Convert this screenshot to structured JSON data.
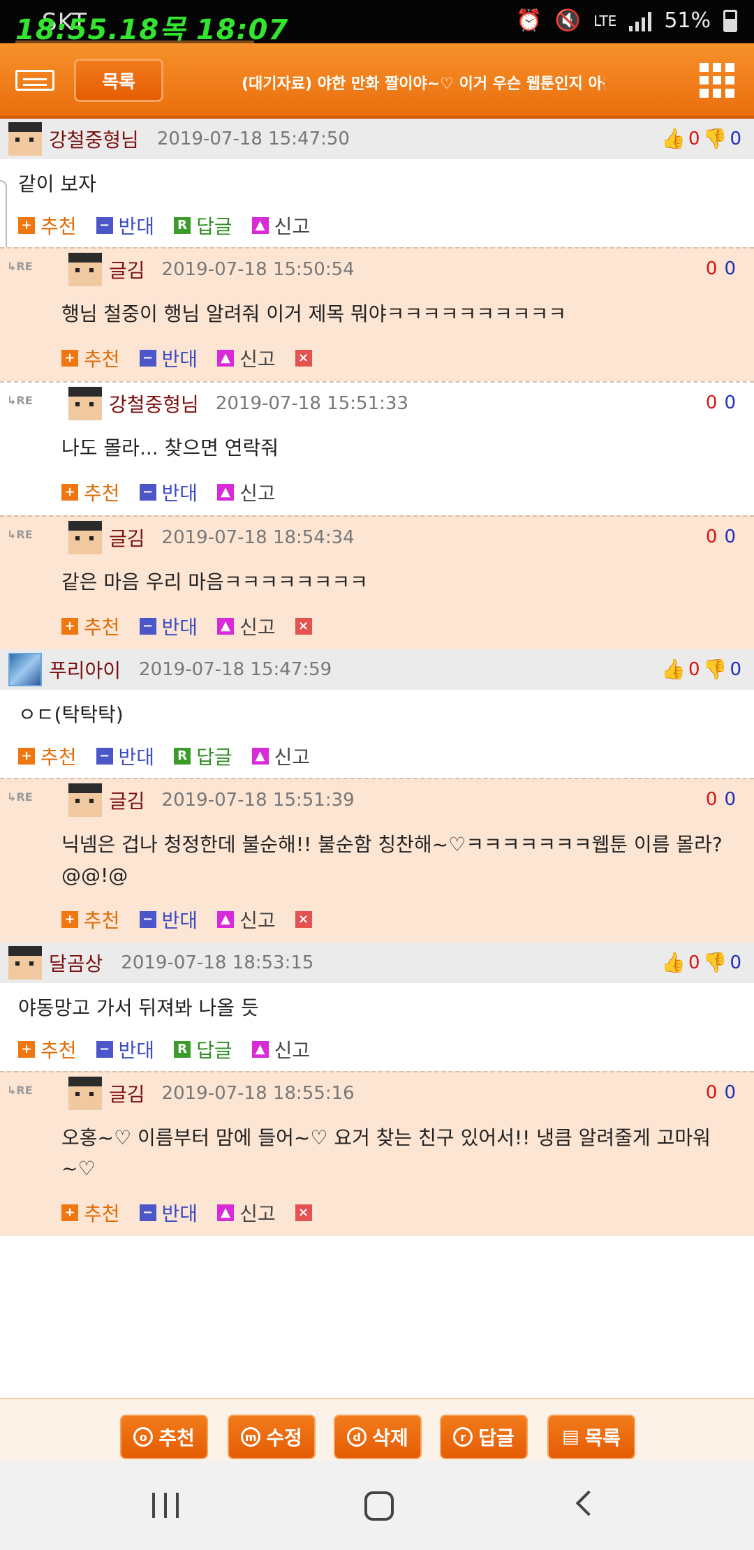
{
  "status": {
    "carrier": "SKT",
    "overlay": "18:55.18목 18:07",
    "lte": "LTE",
    "battery": "51%"
  },
  "header": {
    "list_button": "목록",
    "title": "(대기자료) 야한 만화 짤이야~♡ 이거 우슨 웹툰인지 아는 사.."
  },
  "labels": {
    "recommend": "추천",
    "oppose": "반대",
    "reply": "답글",
    "report": "신고",
    "re": "RE",
    "zero": "0"
  },
  "comments": [
    {
      "user": "강철중형님",
      "date": "2019-07-18 15:47:50",
      "up": "0",
      "down": "0",
      "text": "같이 보자",
      "replies": [
        {
          "user": "글김",
          "date": "2019-07-18 15:50:54",
          "text": "행님 철중이 행님 알려줘 이거 제목 뭐야ㅋㅋㅋㅋㅋㅋㅋㅋㅋㅋ",
          "up": "0",
          "down": "0",
          "deletable": true,
          "bg": "tan"
        },
        {
          "user": "강철중형님",
          "date": "2019-07-18 15:51:33",
          "text": "나도 몰라... 찾으면 연락줘",
          "up": "0",
          "down": "0",
          "deletable": false,
          "bg": "white"
        },
        {
          "user": "글김",
          "date": "2019-07-18 18:54:34",
          "text": "같은 마음 우리 마음ㅋㅋㅋㅋㅋㅋㅋㅋ",
          "up": "0",
          "down": "0",
          "deletable": true,
          "bg": "tan"
        }
      ]
    },
    {
      "user": "푸리아이",
      "date": "2019-07-18 15:47:59",
      "up": "0",
      "down": "0",
      "text": "ㅇㄷ(탁탁탁)",
      "avatar": "image",
      "replies": [
        {
          "user": "글김",
          "date": "2019-07-18 15:51:39",
          "text": "닉넴은 겁나 청정한데 불순해!! 불순함 칭찬해~♡ㅋㅋㅋㅋㅋㅋㅋ웹툰 이름 몰라?@@!@",
          "up": "0",
          "down": "0",
          "deletable": true,
          "bg": "tan"
        }
      ]
    },
    {
      "user": "달곰상",
      "date": "2019-07-18 18:53:15",
      "up": "0",
      "down": "0",
      "text": "야동망고 가서 뒤져봐 나올 듯",
      "replies": [
        {
          "user": "글김",
          "date": "2019-07-18 18:55:16",
          "text": "오홍~♡ 이름부터 맘에 들어~♡ 요거 찾는 친구 있어서!! 냉큼 알려줄게 고마워~♡",
          "up": "0",
          "down": "0",
          "deletable": true,
          "bg": "tan"
        }
      ]
    }
  ],
  "bottom": [
    {
      "icon": "o",
      "label": "추천"
    },
    {
      "icon": "m",
      "label": "수정"
    },
    {
      "icon": "d",
      "label": "삭제"
    },
    {
      "icon": "r",
      "label": "답글"
    },
    {
      "icon": "list",
      "label": "목록"
    }
  ],
  "colors": {
    "accent": "#ef7414",
    "reply_bg": "#fde5d3",
    "header_bg": "#ebebeb"
  }
}
